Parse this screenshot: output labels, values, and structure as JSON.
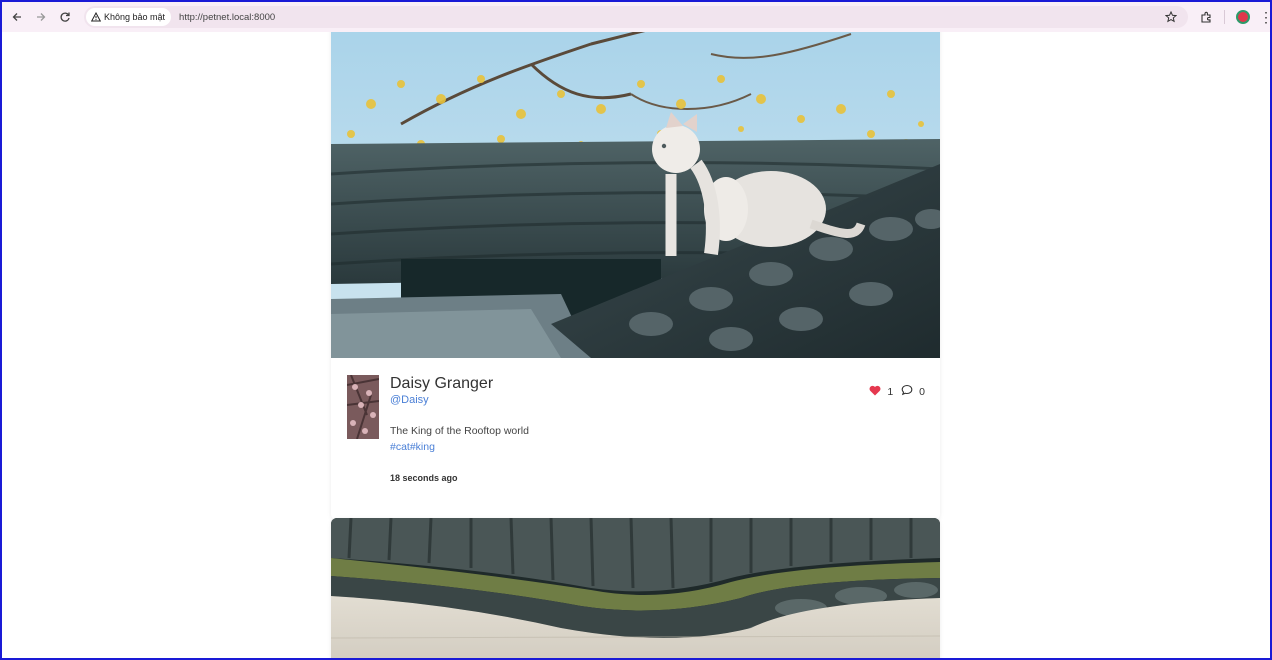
{
  "browser": {
    "security_label": "Không bảo mật",
    "url": "http://petnet.local:8000",
    "icons": [
      "back-arrow-icon",
      "forward-arrow-icon",
      "reload-icon",
      "warning-icon",
      "star-icon",
      "extensions-icon",
      "profile-icon",
      "menu-dots-icon"
    ]
  },
  "posts": [
    {
      "author_name": "Daisy Granger",
      "handle": "@Daisy",
      "caption": "The King of the Rooftop world",
      "tags": "#cat#king",
      "timestamp": "18 seconds ago",
      "likes": "1",
      "comments": "0",
      "liked": true,
      "like_color": "#e5384f"
    }
  ],
  "colors": {
    "link": "#4a7fd6",
    "toolbar_bg": "#f9eff7",
    "omnibox_bg": "#f1e4ee"
  }
}
